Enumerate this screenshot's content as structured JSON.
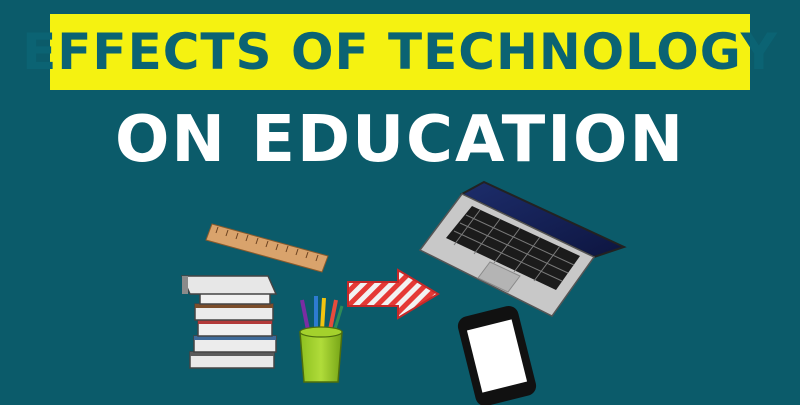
{
  "title": {
    "line1": "EFFECTS OF TECHNOLOGY",
    "line2": "ON EDUCATION"
  },
  "colors": {
    "background": "#0b5b6a",
    "banner": "#f5f211",
    "title_line1": "#0b6373",
    "title_line2": "#ffffff",
    "arrow": "#e53935"
  },
  "illustration": {
    "items": [
      "ruler-icon",
      "book-stack-icon",
      "pencil-cup-icon",
      "arrow-icon",
      "laptop-icon",
      "smartphone-icon"
    ]
  }
}
